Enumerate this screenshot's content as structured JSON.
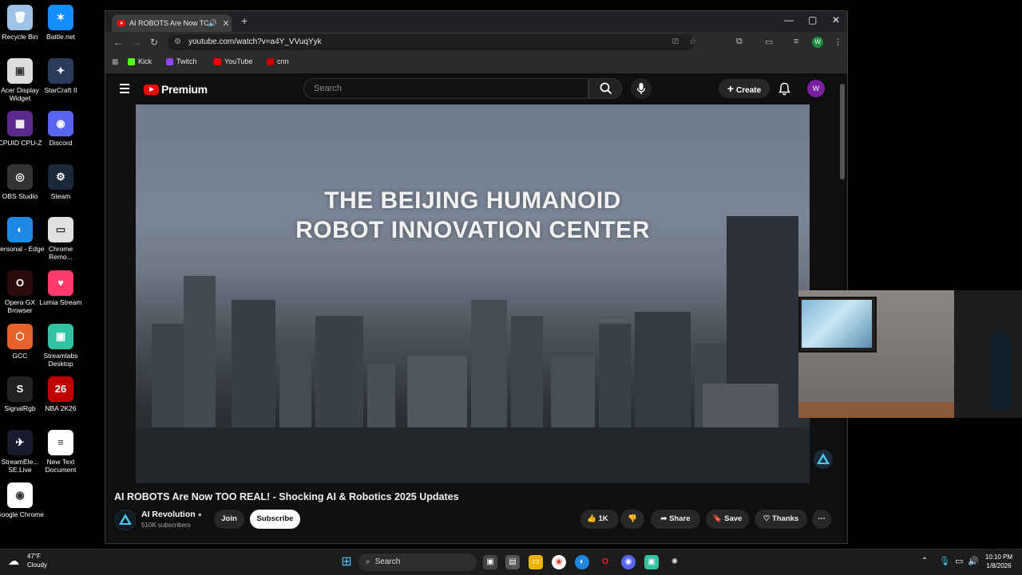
{
  "desktop": {
    "icons": [
      {
        "label": "Recycle Bin",
        "color": "#9ec3e6",
        "glyph": "🗑"
      },
      {
        "label": "Battle.net",
        "color": "#148eff",
        "glyph": "✶"
      },
      {
        "label": "Acer Display Widget",
        "color": "#dddddd",
        "glyph": "▣"
      },
      {
        "label": "StarCraft II",
        "color": "#2a3c5a",
        "glyph": "✦"
      },
      {
        "label": "CPUID CPU-Z",
        "color": "#5b2a8c",
        "glyph": "▦"
      },
      {
        "label": "Discord",
        "color": "#5865f2",
        "glyph": "◉"
      },
      {
        "label": "OBS Studio",
        "color": "#333333",
        "glyph": "◎"
      },
      {
        "label": "Steam",
        "color": "#1b2838",
        "glyph": "⚙"
      },
      {
        "label": "Personal - Edge",
        "color": "#1e88e5",
        "glyph": "◐"
      },
      {
        "label": "Chrome Remo...",
        "color": "#e0e0e0",
        "glyph": "▭"
      },
      {
        "label": "Opera GX Browser",
        "color": "#2a0a0a",
        "glyph": "O"
      },
      {
        "label": "Lumia Stream",
        "color": "#ff3b6b",
        "glyph": "♥"
      },
      {
        "label": "GCC",
        "color": "#e8622c",
        "glyph": "⬡"
      },
      {
        "label": "Streamlabs Desktop",
        "color": "#31c3a2",
        "glyph": "▣"
      },
      {
        "label": "SignalRgb",
        "color": "#222222",
        "glyph": "S"
      },
      {
        "label": "NBA 2K26",
        "color": "#c00000",
        "glyph": "26"
      },
      {
        "label": "StreamEle... SE.Live",
        "color": "#1a1a2e",
        "glyph": "✈"
      },
      {
        "label": "New Text Document",
        "color": "#ffffff",
        "glyph": "≡"
      },
      {
        "label": "Google Chrome",
        "color": "#ffffff",
        "glyph": "◉"
      }
    ]
  },
  "browser": {
    "tab_title": "AI ROBOTS Are Now TOO R",
    "tab_audio_icon": "speaker-icon",
    "url": "youtube.com/watch?v=a4Y_VVuqYyk",
    "profile_initial": "W",
    "bookmarks": [
      {
        "label": "Kick",
        "color": "#53fc18"
      },
      {
        "label": "Twitch",
        "color": "#9146ff"
      },
      {
        "label": "YouTube",
        "color": "#ff0000"
      },
      {
        "label": "cnn",
        "color": "#cc0000"
      }
    ]
  },
  "youtube": {
    "logo_text": "Premium",
    "search_placeholder": "Search",
    "create_label": "Create",
    "avatar_initial": "W",
    "video_caption_line1": "THE BEIJING HUMANOID",
    "video_caption_line2": "ROBOT INNOVATION CENTER",
    "video_title": "AI ROBOTS Are Now TOO REAL! - Shocking AI & Robotics 2025 Updates",
    "channel_name": "AI Revolution",
    "subscribers": "510K subscribers",
    "join_label": "Join",
    "subscribe_label": "Subscribe",
    "like_count": "1K",
    "share_label": "Share",
    "save_label": "Save",
    "thanks_label": "Thanks"
  },
  "taskbar": {
    "weather_temp": "47°F",
    "weather_desc": "Cloudy",
    "search_label": "Search",
    "time": "10:10 PM",
    "date": "1/8/2026"
  }
}
